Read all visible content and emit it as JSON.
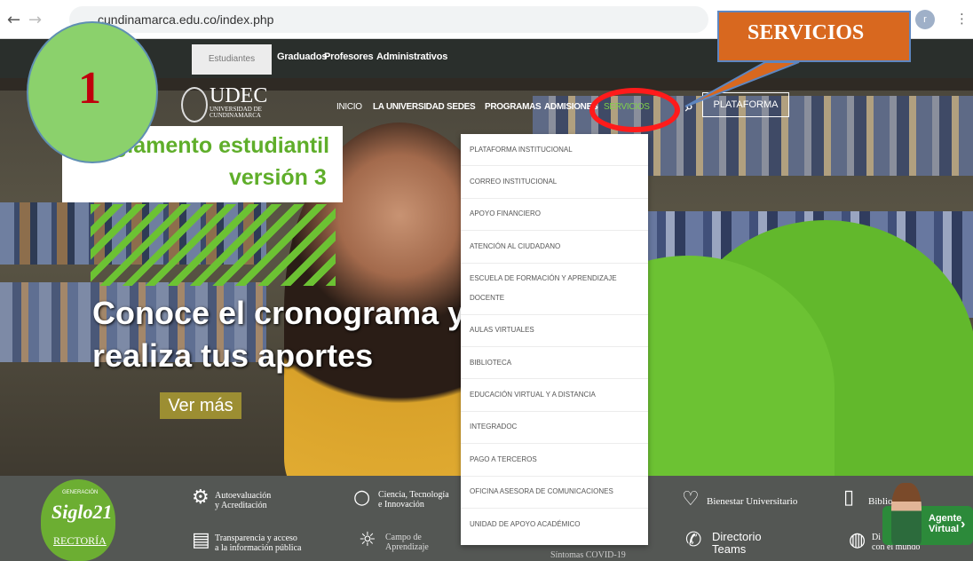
{
  "browser": {
    "back": "←",
    "forward": "→",
    "url": "cundinamarca.edu.co/index.php",
    "avatar_letter": "r",
    "menu_icon": "≡",
    "more_icon": "⋮"
  },
  "top_nav": {
    "active_item": "Estudiantes",
    "items": [
      "Graduados",
      "Profesores",
      "Administrativos"
    ]
  },
  "logo": {
    "main": "UDEC",
    "sub1": "UNIVERSIDAD DE",
    "sub2": "CUNDINAMARCA"
  },
  "main_nav": {
    "items": [
      "INICIO",
      "LA UNIVERSIDAD",
      "SEDES",
      "PROGRAMAS",
      "ADMISIONES",
      "SERVICIOS"
    ],
    "search_icon": "⌕",
    "plataforma": "PLATAFORMA"
  },
  "hero": {
    "reglamento_line1": "glamento estudiantil",
    "reglamento_line2": "versión 3",
    "headline_line1": "Conoce el cronograma y",
    "headline_line2": "realiza tus aportes",
    "cta": "Ver más"
  },
  "dropdown": {
    "items": [
      "PLATAFORMA INSTITUCIONAL",
      "CORREO INSTITUCIONAL",
      "APOYO FINANCIERO",
      "ATENCIÓN AL CIUDADANO",
      "ESCUELA DE FORMACIÓN Y APRENDIZAJE DOCENTE",
      "AULAS VIRTUALES",
      "BIBLIOTECA",
      "EDUCACIÓN VIRTUAL Y A DISTANCIA",
      "INTEGRADOC",
      "PAGO A TERCEROS",
      "OFICINA ASESORA DE COMUNICACIONES",
      "UNIDAD DE APOYO ACADÉMICO"
    ]
  },
  "annotations": {
    "number": "1",
    "callout": "SERVICIOS"
  },
  "footer": {
    "siglo": "Siglo21",
    "siglo_small": "GENERACIÓN",
    "rectoria": "RECTORÍA",
    "autoeval": "Autoevaluación\ny Acreditación",
    "ciencia": "Ciencia, Tecnología\ne Innovación",
    "transparencia": "Transparencia y acceso\na la información pública",
    "campo": "Campo de\nAprendizaje",
    "covid": "Síntomas COVID-19",
    "bienestar": "Bienestar Universitario",
    "directorio": "Directorio\nTeams",
    "biblio": "Biblio",
    "dialogando": "Di\ncon el mundo"
  },
  "agente": {
    "line1": "Agente",
    "line2": "Virtual"
  },
  "colors": {
    "accent_green": "#62b82c",
    "callout_orange": "#d8681f",
    "highlight_red": "#ff1b1b"
  }
}
